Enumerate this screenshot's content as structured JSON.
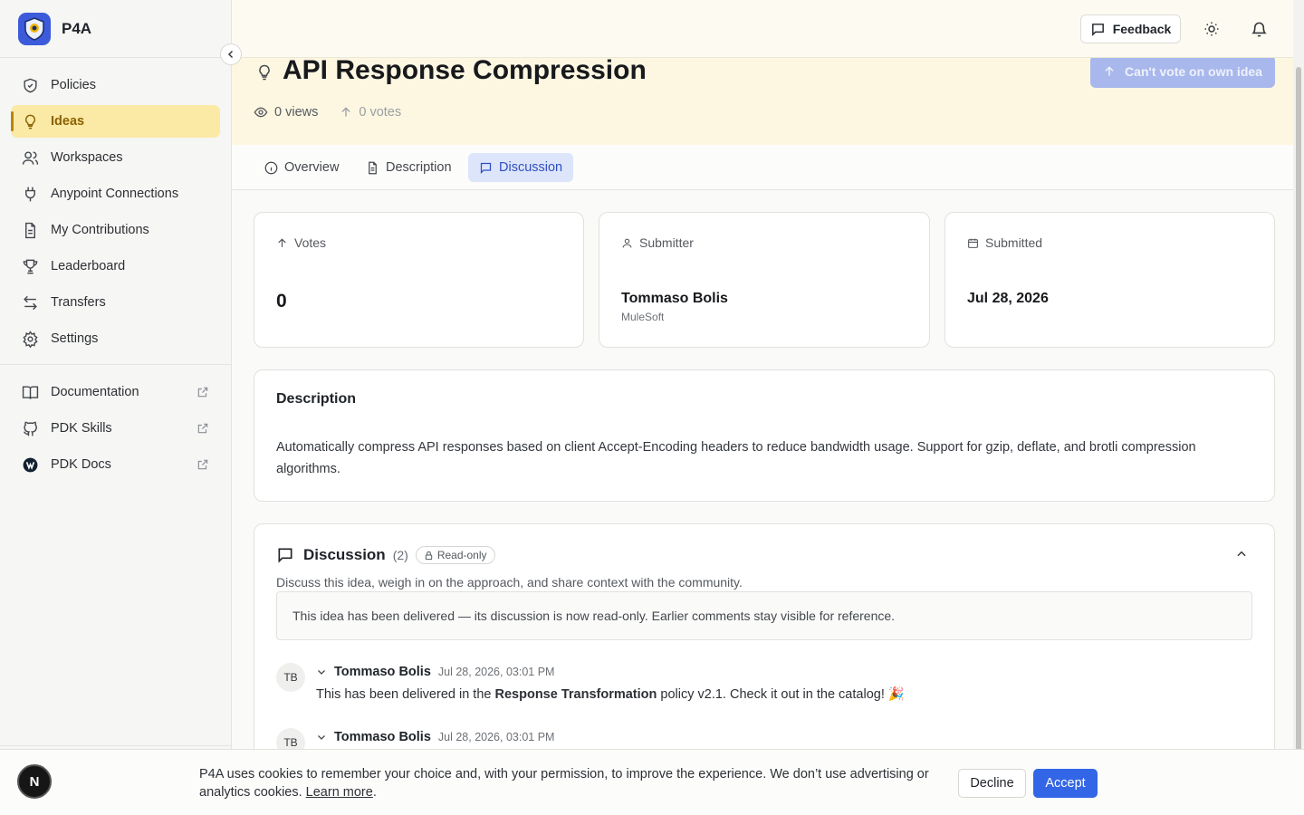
{
  "app": {
    "name": "P4A"
  },
  "sidebar": {
    "items": [
      {
        "label": "Policies"
      },
      {
        "label": "Ideas"
      },
      {
        "label": "Workspaces"
      },
      {
        "label": "Anypoint Connections"
      },
      {
        "label": "My Contributions"
      },
      {
        "label": "Leaderboard"
      },
      {
        "label": "Transfers"
      },
      {
        "label": "Settings"
      }
    ],
    "links": [
      {
        "label": "Documentation"
      },
      {
        "label": "PDK Skills"
      },
      {
        "label": "PDK Docs"
      }
    ],
    "user_initial": "N"
  },
  "topbar": {
    "feedback_label": "Feedback"
  },
  "idea": {
    "title": "API Response Compression",
    "views": "0 views",
    "votes_meta": "0 votes",
    "vote_button": "Can't vote on own idea"
  },
  "tabs": [
    {
      "label": "Overview"
    },
    {
      "label": "Description"
    },
    {
      "label": "Discussion"
    }
  ],
  "stats": {
    "votes_label": "Votes",
    "votes_value": "0",
    "submitter_label": "Submitter",
    "submitter_name": "Tommaso Bolis",
    "submitter_org": "MuleSoft",
    "submitted_label": "Submitted",
    "submitted_date": "Jul 28, 2026"
  },
  "description": {
    "title": "Description",
    "text": "Automatically compress API responses based on client Accept-Encoding headers to reduce bandwidth usage. Support for gzip, deflate, and brotli compression algorithms."
  },
  "discussion": {
    "title": "Discussion",
    "count": "(2)",
    "badge": "Read-only",
    "subtitle": "Discuss this idea, weigh in on the approach, and share context with the community.",
    "notice": "This idea has been delivered — its discussion is now read-only. Earlier comments stay visible for reference.",
    "comments": [
      {
        "initials": "TB",
        "author": "Tommaso Bolis",
        "time": "Jul 28, 2026, 03:01 PM",
        "body_before": "This has been delivered in the ",
        "body_bold": "Response Transformation",
        "body_after": " policy v2.1. Check it out in the catalog! 🎉"
      },
      {
        "initials": "TB",
        "author": "Tommaso Bolis",
        "time": "Jul 28, 2026, 03:01 PM"
      }
    ]
  },
  "cookie": {
    "text": "P4A uses cookies to remember your choice and, with your permission, to improve the experience. We don’t use advertising or analytics cookies. ",
    "link": "Learn more",
    "period": ".",
    "decline": "Decline",
    "accept": "Accept"
  },
  "colors": {
    "accent": "#3366e6",
    "active_nav_bg": "#fbe9a6",
    "hero_bg": "#fdf7e2"
  }
}
